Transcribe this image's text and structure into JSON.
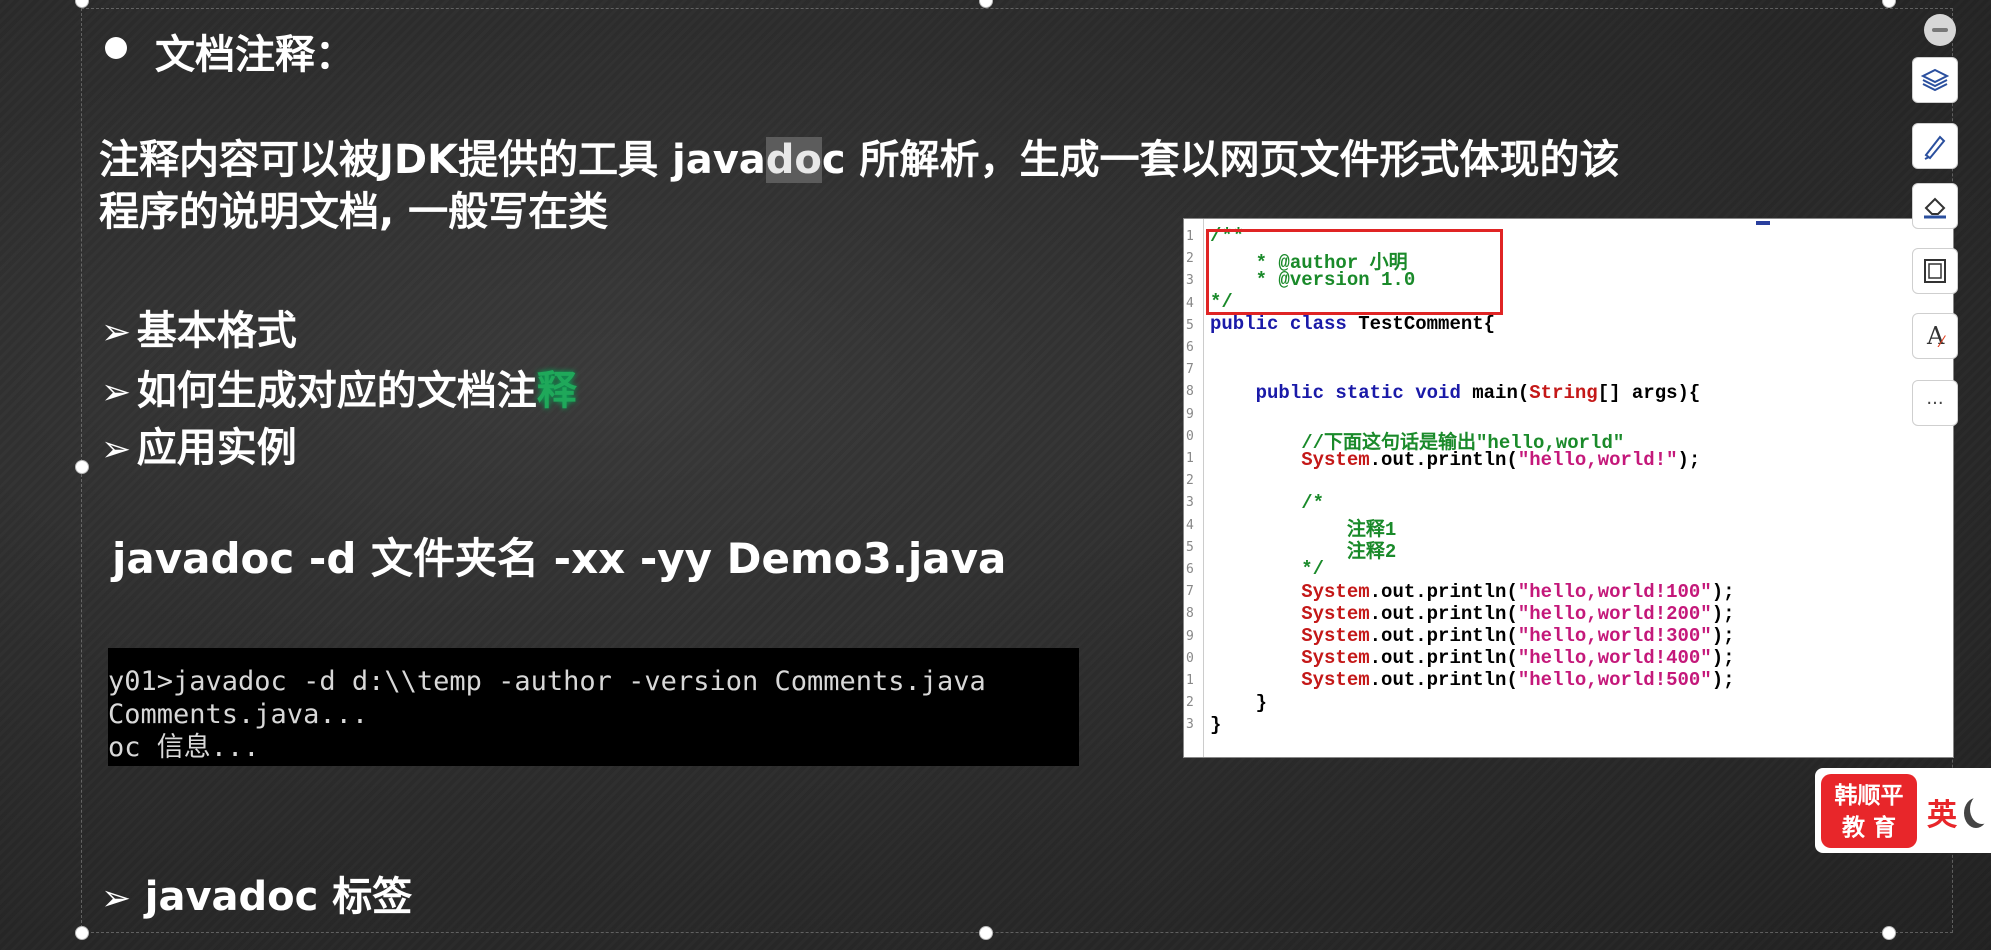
{
  "slide": {
    "heading": "文档注释：",
    "paragraph_pre": "注释内容可以被JDK提供的工具 java",
    "paragraph_hl": "do",
    "paragraph_post": "c 所解析，生成一套以网页文件形式体现的该",
    "paragraph_line2": "程序的说明文档, 一般写在类",
    "arrow_glyph": "➢",
    "items": [
      "基本格式",
      "如何生成对应的文档注",
      "应用实例"
    ],
    "item2_tail": "释",
    "command": "javadoc -d 文件夹名 -xx -yy Demo3.java",
    "last_item": "javadoc 标签"
  },
  "terminal": {
    "lines": [
      "y01>javadoc -d d:\\\\temp -author -version Comments.java",
      "Comments.java...",
      "oc 信息..."
    ]
  },
  "code": {
    "line_numbers": [
      "1",
      "2",
      "3",
      "4",
      "5",
      "6",
      "7",
      "8",
      "9",
      "0",
      "1",
      "2",
      "3",
      "4",
      "5",
      "6",
      "7",
      "8",
      "9",
      "0",
      "1",
      "2",
      "3"
    ],
    "l1": "/**",
    "l2": "    * @author 小明",
    "l3": "    * @version 1.0",
    "l4": "*/",
    "l5_kw": "public class",
    "l5_name": " TestComment{",
    "l8_kw": "    public static void",
    "l8_main": " main(",
    "l8_type": "String",
    "l8_rest": "[] args){",
    "l10": "        //下面这句话是输出\"hello,world\"",
    "println_prefix_sys": "        System",
    "println_prefix_rest": ".out.println(",
    "println_close": ");",
    "s0": "\"hello,world!\"",
    "l12": "        /*",
    "l13": "            注释1",
    "l14": "            注释2",
    "l15": "        */",
    "s1": "\"hello,world!100\"",
    "s2": "\"hello,world!200\"",
    "s3": "\"hello,world!300\"",
    "s4": "\"hello,world!400\"",
    "s5": "\"hello,world!500\"",
    "close_inner": "    }",
    "close_outer": "}"
  },
  "toolbar": {
    "icons": [
      "minus-icon",
      "layers-icon",
      "pen-icon",
      "eraser-icon",
      "frame-icon",
      "text-pen-icon",
      "more-icon"
    ],
    "more_label": "···",
    "text_label": "A"
  },
  "brand": {
    "line1": "韩顺平",
    "line2": "教 育",
    "side": "英"
  },
  "colors": {
    "keyword": "#1a1aa8",
    "comment": "#1a8a2a",
    "string": "#c4187a",
    "system": "#c41818",
    "highlight_box": "#e02424",
    "brand_red": "#e8262a"
  }
}
